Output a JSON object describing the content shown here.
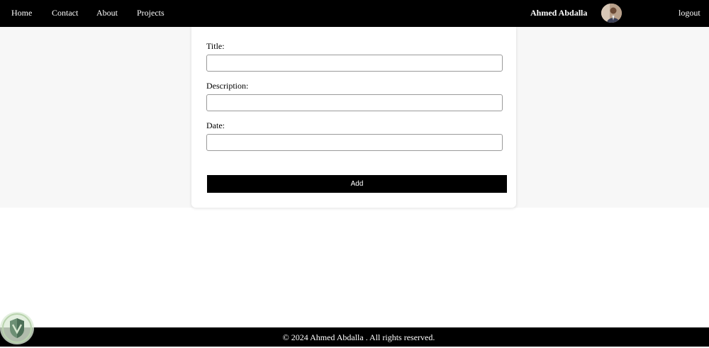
{
  "nav": {
    "links": [
      {
        "label": "Home"
      },
      {
        "label": "Contact"
      },
      {
        "label": "About"
      },
      {
        "label": "Projects"
      }
    ],
    "user_name": "Ahmed Abdalla",
    "avatar_icon": "user-photo",
    "logout_label": "logout"
  },
  "form": {
    "title_label": "Title:",
    "title_value": "",
    "description_label": "Description:",
    "description_value": "",
    "date_label": "Date:",
    "date_value": "",
    "add_label": "Add"
  },
  "footer": {
    "text": "© 2024 Ahmed Abdalla . All rights reserved."
  },
  "colors": {
    "nav_bg": "#000000",
    "page_bg": "#f7f7f7",
    "button_bg": "#000000",
    "text_on_dark": "#ffffff"
  },
  "icons": {
    "badge_icon": "shield-icon"
  }
}
